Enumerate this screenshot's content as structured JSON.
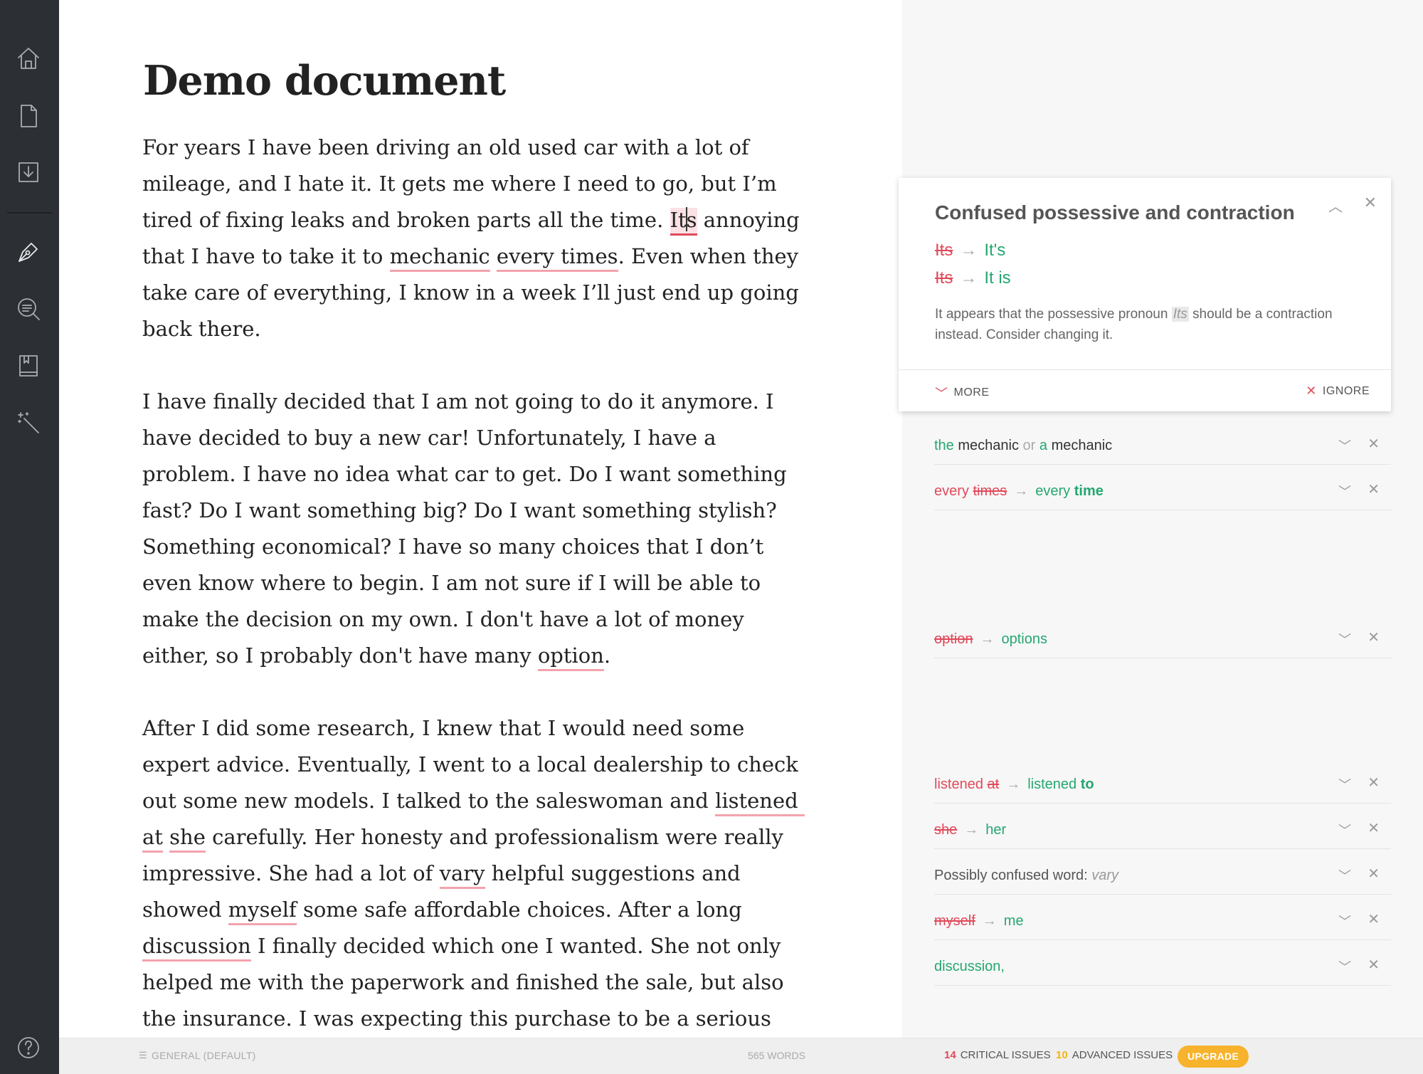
{
  "sidebar": {
    "icons": [
      "home-icon",
      "new-document-icon",
      "download-icon",
      "pen-icon",
      "search-icon",
      "book-icon",
      "magic-wand-icon",
      "help-icon"
    ]
  },
  "document": {
    "title": "Demo document",
    "p1": {
      "a": "For years I have been driving an old used car with a lot of mileage, and I hate it. It gets me where I need to go, but I’m tired of fixing leaks and broken parts all the time. ",
      "its_1": "It",
      "its_2": "s",
      "b": " annoying that I have to take it to ",
      "mechanic": "mechanic",
      "c": " ",
      "every_times": "every times",
      "d": ". Even when they take care of everything, I know in a week I’ll just end up going back there."
    },
    "p2": {
      "a": "I have finally decided that I am not going to do it anymore. I have decided to buy a new car! Unfortunately, I have a problem. I have no idea what car to get. Do I want something fast? Do I want something big? Do I want something stylish? Something economical? I have so many choices that I don’t even know where to begin. I am not sure if I will be able to make the decision on my own. I don't have a lot of money either, so I probably don't have many ",
      "option": "option",
      "b": "."
    },
    "p3": {
      "a": "After I did some research, I knew that I would need some expert advice. Eventually, I went to a local dealership to check out some new models. I talked to the saleswoman and ",
      "listened_at": "listened at",
      "b": " ",
      "she": "she",
      "c": " carefully. Her honesty and professionalism were really impressive. She had a lot of ",
      "vary": "vary",
      "d": " helpful suggestions and showed ",
      "myself": "myself",
      "e": " some safe affordable choices. After a long ",
      "discussion": "discussion",
      "f": " I finally decided which one I wanted. She not only helped me with the paperwork and finished the sale, but also the insurance. I was expecting this purchase to be a serious hassle, but the experience"
    }
  },
  "card": {
    "title": "Confused possessive and contraction",
    "suggestions": [
      {
        "from": "Its",
        "to": "It's"
      },
      {
        "from": "Its",
        "to": "It is"
      }
    ],
    "arrow": "→",
    "desc_a": "It appears that the possessive pronoun ",
    "desc_hl": "Its",
    "desc_b": " should be a contraction instead. Consider changing it.",
    "more_label": "MORE",
    "ignore_label": "IGNORE"
  },
  "issues": {
    "mechanic": {
      "a1": "the",
      "a2": " mechanic ",
      "or": "or",
      "b1": " a",
      "b2": " mechanic"
    },
    "every_times": {
      "keep": "every ",
      "from": "times",
      "to_keep": "every ",
      "to": "time"
    },
    "option": {
      "from": "option",
      "to": "options"
    },
    "listened_at": {
      "keep": "listened ",
      "from": "at",
      "to_keep": "listened ",
      "to": "to"
    },
    "she": {
      "from": "she",
      "to": "her"
    },
    "vary": {
      "label": "Possibly confused word: ",
      "word": "vary"
    },
    "myself": {
      "from": "myself",
      "to": "me"
    },
    "discussion": {
      "text": "discussion,"
    }
  },
  "statusbar": {
    "mode": "GENERAL (DEFAULT)",
    "words": "565 WORDS",
    "critical_count": "14",
    "critical_label": "CRITICAL ISSUES",
    "advanced_count": "10",
    "advanced_label": "ADVANCED ISSUES",
    "upgrade": "UPGRADE"
  },
  "colors": {
    "sidebar": "#2c2f33",
    "error_red": "#e04a5a",
    "success_green": "#25a770",
    "upgrade_yellow": "#f7b32b"
  }
}
